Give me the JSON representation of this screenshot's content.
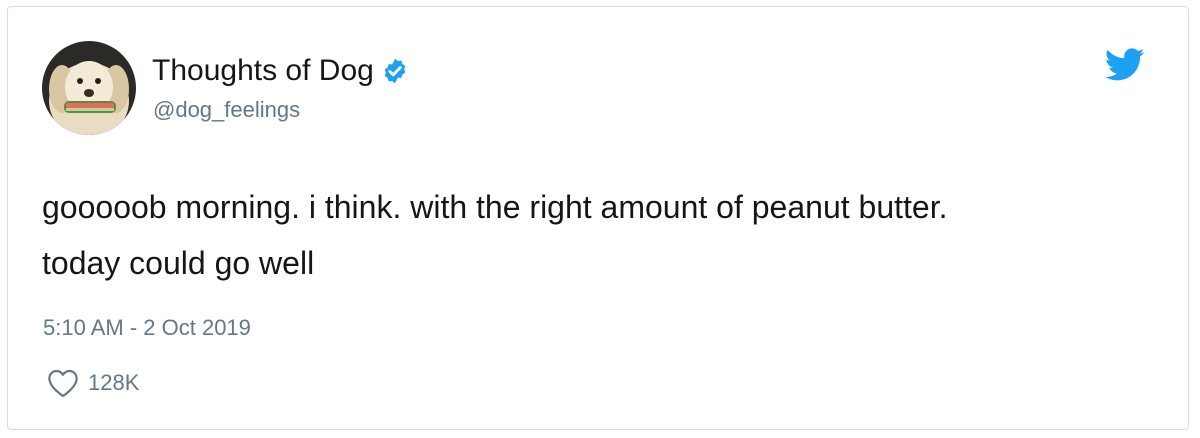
{
  "tweet": {
    "author": {
      "display_name": "Thoughts of Dog",
      "handle": "@dog_feelings",
      "verified": true,
      "avatar_icon": "dog-avatar"
    },
    "text_lines": [
      "gooooob morning. i think. with the right amount of peanut butter.",
      "today could go well"
    ],
    "timestamp": "5:10 AM - 2 Oct 2019",
    "likes": "128K",
    "brand_icon": "twitter-bird-icon",
    "like_icon": "heart-outline-icon",
    "colors": {
      "brand_blue": "#1da1f2",
      "secondary_text": "#657786",
      "primary_text": "#14171a",
      "border": "#d9dde1"
    }
  }
}
